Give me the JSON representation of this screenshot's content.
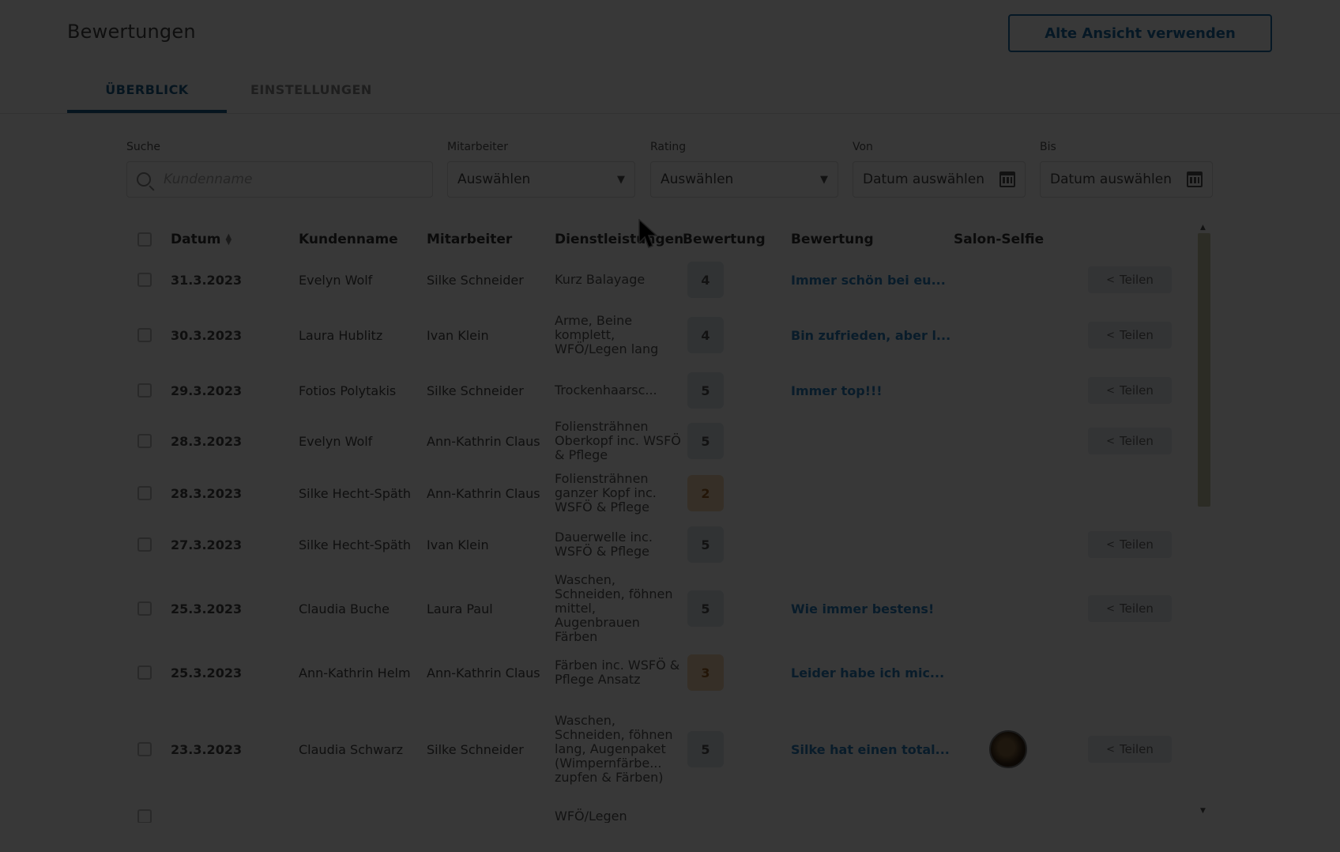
{
  "header": {
    "title": "Bewertungen",
    "old_view_button": "Alte Ansicht verwenden"
  },
  "tabs": [
    {
      "label": "ÜBERBLICK",
      "active": true
    },
    {
      "label": "EINSTELLUNGEN",
      "active": false
    }
  ],
  "filters": {
    "search": {
      "label": "Suche",
      "placeholder": "Kundenname",
      "icon": "search-icon"
    },
    "employee": {
      "label": "Mitarbeiter",
      "value": "Auswählen"
    },
    "rating": {
      "label": "Rating",
      "value": "Auswählen"
    },
    "from": {
      "label": "Von",
      "value": "Datum auswählen",
      "icon": "calendar-icon"
    },
    "to": {
      "label": "Bis",
      "value": "Datum auswählen",
      "icon": "calendar-icon"
    }
  },
  "table": {
    "columns": [
      "Datum",
      "Kundenname",
      "Mitarbeiter",
      "Dienstleistungen",
      "Bewertung",
      "Bewertung",
      "Salon-Selfie"
    ],
    "share_label": "Teilen",
    "rows": [
      {
        "date": "31.3.2023",
        "customer": "Evelyn Wolf",
        "employee": "Silke Schneider",
        "service": "Kurz Balayage",
        "rating": "4",
        "review": "Immer schön bei eu...",
        "selfie": false,
        "share": true
      },
      {
        "date": "30.3.2023",
        "customer": "Laura Hublitz",
        "employee": "Ivan Klein",
        "service": "Arme, Beine komplett, WFÖ/Legen lang",
        "rating": "4",
        "review": "Bin zufrieden, aber l...",
        "selfie": false,
        "share": true
      },
      {
        "date": "29.3.2023",
        "customer": "Fotios Polytakis",
        "employee": "Silke Schneider",
        "service": "Trockenhaarsc...",
        "rating": "5",
        "review": "Immer top!!!",
        "selfie": false,
        "share": true
      },
      {
        "date": "28.3.2023",
        "customer": "Evelyn Wolf",
        "employee": "Ann-Kathrin Claus",
        "service": "Foliensträhnen Oberkopf inc. WSFÖ & Pflege",
        "rating": "5",
        "review": "",
        "selfie": false,
        "share": true
      },
      {
        "date": "28.3.2023",
        "customer": "Silke Hecht-Späth",
        "employee": "Ann-Kathrin Claus",
        "service": "Foliensträhnen ganzer Kopf inc. WSFÖ & Pflege",
        "rating": "2",
        "review": "",
        "selfie": false,
        "share": false
      },
      {
        "date": "27.3.2023",
        "customer": "Silke Hecht-Späth",
        "employee": "Ivan Klein",
        "service": "Dauerwelle inc. WSFÖ & Pflege",
        "rating": "5",
        "review": "",
        "selfie": false,
        "share": true
      },
      {
        "date": "25.3.2023",
        "customer": "Claudia Buche",
        "employee": "Laura Paul",
        "service": "Waschen, Schneiden, föhnen mittel, Augenbrauen Färben",
        "rating": "5",
        "review": "Wie immer bestens!",
        "selfie": false,
        "share": true
      },
      {
        "date": "25.3.2023",
        "customer": "Ann-Kathrin Helm",
        "employee": "Ann-Kathrin Claus",
        "service": "Färben inc. WSFÖ & Pflege Ansatz",
        "rating": "3",
        "review": "Leider habe ich mic...",
        "selfie": false,
        "share": false
      },
      {
        "date": "23.3.2023",
        "customer": "Claudia Schwarz",
        "employee": "Silke Schneider",
        "service": "Waschen, Schneiden, föhnen lang, Augenpaket (Wimpernfärbe... zupfen & Färben)",
        "rating": "5",
        "review": "Silke hat einen total...",
        "selfie": true,
        "share": true
      },
      {
        "date": "",
        "customer": "",
        "employee": "",
        "service": "WFÖ/Legen",
        "rating": "",
        "review": "",
        "selfie": false,
        "share": false
      }
    ]
  },
  "colors": {
    "accent": "#1e5f8f",
    "link": "#2a7fbf",
    "overlay": "#000000"
  }
}
